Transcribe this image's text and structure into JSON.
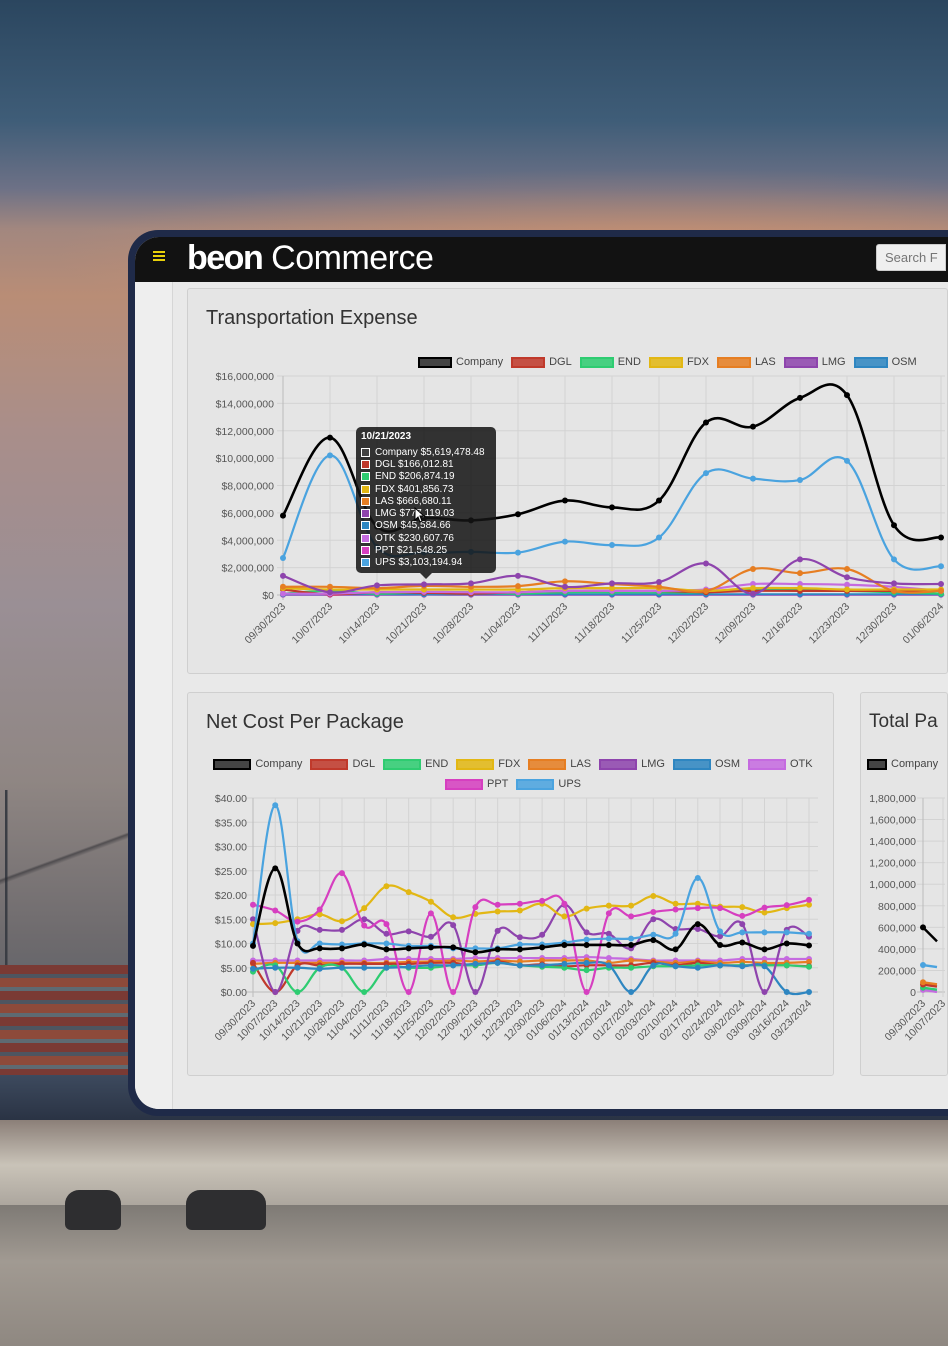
{
  "header": {
    "logo_bold": "beon",
    "logo_light": " Commerce",
    "search_placeholder": "Search F"
  },
  "colors": {
    "Company": "#000000",
    "DGL": "#c0392b",
    "END": "#2ecc71",
    "FDX": "#e2b714",
    "LAS": "#e67e22",
    "LMG": "#8e44ad",
    "OSM": "#2e86c1",
    "OTK": "#c56be0",
    "PPT": "#d63fc0",
    "UPS": "#4aa3df",
    "accent": "#e8d00a"
  },
  "tooltip": {
    "title": "10/21/2023",
    "rows": [
      {
        "series": "Company",
        "text": "Company $5,619,478.48"
      },
      {
        "series": "DGL",
        "text": "DGL $166,012.81"
      },
      {
        "series": "END",
        "text": "END $206,874.19"
      },
      {
        "series": "FDX",
        "text": "FDX $401,856.73"
      },
      {
        "series": "LAS",
        "text": "LAS $666,680.11"
      },
      {
        "series": "LMG",
        "text": "LMG $777,119.03"
      },
      {
        "series": "OSM",
        "text": "OSM $45,584.66"
      },
      {
        "series": "OTK",
        "text": "OTK $230,607.76"
      },
      {
        "series": "PPT",
        "text": "PPT $21,548.25"
      },
      {
        "series": "UPS",
        "text": "UPS $3,103,194.94"
      }
    ]
  },
  "chart_data": [
    {
      "title": "Transportation Expense",
      "type": "line",
      "legend": [
        "Company",
        "DGL",
        "END",
        "FDX",
        "LAS",
        "LMG",
        "OSM"
      ],
      "legend_placement": "top",
      "grid": true,
      "y_ticks": [
        "$0",
        "$2,000,000",
        "$4,000,000",
        "$6,000,000",
        "$8,000,000",
        "$10,000,000",
        "$12,000,000",
        "$14,000,000",
        "$16,000,000"
      ],
      "ylim": [
        0,
        16000000
      ],
      "x": [
        "09/30/2023",
        "10/07/2023",
        "10/14/2023",
        "10/21/2023",
        "10/28/2023",
        "11/04/2023",
        "11/11/2023",
        "11/18/2023",
        "11/25/2023",
        "12/02/2023",
        "12/09/2023",
        "12/16/2023",
        "12/23/2023",
        "12/30/2023",
        "01/06/2024"
      ],
      "series": [
        {
          "name": "PPT",
          "values": [
            20000,
            20000,
            20000,
            21548,
            20000,
            20000,
            20000,
            20000,
            20000,
            20000,
            20000,
            20000,
            20000,
            20000,
            20000
          ]
        },
        {
          "name": "OSM",
          "values": [
            50000,
            50000,
            50000,
            45585,
            50000,
            50000,
            50000,
            50000,
            50000,
            50000,
            50000,
            50000,
            50000,
            50000,
            50000
          ]
        },
        {
          "name": "END",
          "values": [
            100000,
            300000,
            100000,
            206874,
            200000,
            100000,
            200000,
            200000,
            200000,
            200000,
            400000,
            400000,
            300000,
            200000,
            100000
          ]
        },
        {
          "name": "DGL",
          "values": [
            400000,
            50000,
            200000,
            166013,
            100000,
            200000,
            300000,
            300000,
            300000,
            200000,
            300000,
            300000,
            300000,
            300000,
            300000
          ]
        },
        {
          "name": "OTK",
          "values": [
            100000,
            100000,
            200000,
            230608,
            200000,
            200000,
            300000,
            300000,
            300000,
            400000,
            800000,
            800000,
            750000,
            600000,
            300000
          ]
        },
        {
          "name": "FDX",
          "values": [
            500000,
            400000,
            400000,
            401857,
            400000,
            400000,
            500000,
            500000,
            500000,
            300000,
            500000,
            500000,
            400000,
            400000,
            400000
          ]
        },
        {
          "name": "LAS",
          "values": [
            600000,
            600000,
            500000,
            666680,
            600000,
            650000,
            1000000,
            800000,
            600000,
            300000,
            1900000,
            1600000,
            1900000,
            300000,
            300000
          ]
        },
        {
          "name": "LMG",
          "values": [
            1400000,
            200000,
            700000,
            777119,
            850000,
            1400000,
            600000,
            850000,
            950000,
            2300000,
            100000,
            2600000,
            1300000,
            850000,
            800000
          ]
        },
        {
          "name": "UPS",
          "values": [
            2700000,
            10200000,
            3500000,
            3103195,
            3150000,
            3100000,
            3900000,
            3650000,
            4200000,
            8900000,
            8500000,
            8400000,
            9800000,
            2600000,
            2100000
          ]
        },
        {
          "name": "Company",
          "values": [
            5800000,
            11500000,
            5000000,
            5619478,
            5450000,
            5900000,
            6900000,
            6400000,
            6900000,
            12600000,
            12300000,
            14400000,
            14600000,
            5100000,
            4200000
          ]
        }
      ]
    },
    {
      "title": "Net Cost Per Package",
      "type": "line",
      "legend": [
        "Company",
        "DGL",
        "END",
        "FDX",
        "LAS",
        "LMG",
        "OSM",
        "OTK",
        "PPT",
        "UPS"
      ],
      "legend_placement": "top",
      "grid": true,
      "y_ticks": [
        "$0.00",
        "$5.00",
        "$10.00",
        "$15.00",
        "$20.00",
        "$25.00",
        "$30.00",
        "$35.00",
        "$40.00"
      ],
      "ylim": [
        0,
        40
      ],
      "x": [
        "09/30/2023",
        "10/07/2023",
        "10/14/2023",
        "10/21/2023",
        "10/28/2023",
        "11/04/2023",
        "11/11/2023",
        "11/18/2023",
        "11/25/2023",
        "12/02/2023",
        "12/09/2023",
        "12/16/2023",
        "12/23/2023",
        "12/30/2023",
        "01/06/2024",
        "01/13/2024",
        "01/20/2024",
        "01/27/2024",
        "02/03/2024",
        "02/10/2024",
        "02/17/2024",
        "02/24/2024",
        "03/02/2024",
        "03/09/2024",
        "03/16/2024",
        "03/23/2024"
      ],
      "series": [
        {
          "name": "OTK",
          "values": [
            6.5,
            6.5,
            6.5,
            6.5,
            6.5,
            6.5,
            6.8,
            6.8,
            6.8,
            6.8,
            7,
            7,
            7,
            7,
            7,
            7.2,
            7,
            6.8,
            6.5,
            6.5,
            6.5,
            6.5,
            6.8,
            6.8,
            6.8,
            6.8
          ]
        },
        {
          "name": "LAS",
          "values": [
            5.8,
            6,
            6,
            6,
            6,
            6,
            6,
            6.2,
            6.3,
            6.5,
            6.3,
            6.5,
            6.3,
            6.5,
            6.5,
            6.5,
            6,
            6.5,
            6.3,
            6,
            6.3,
            6,
            6.2,
            6,
            6,
            6.2
          ]
        },
        {
          "name": "DGL",
          "values": [
            6,
            0,
            5.5,
            5.5,
            5.8,
            5.8,
            5.8,
            5.8,
            6,
            6,
            5.5,
            6.3,
            5.5,
            5.7,
            5.3,
            5.5,
            5.5,
            5.5,
            6,
            5.5,
            6,
            5.5,
            5.5,
            5.5,
            5.5,
            5.3
          ]
        },
        {
          "name": "END",
          "values": [
            4.2,
            5.5,
            0,
            5,
            5,
            0,
            5,
            5,
            5,
            5.5,
            5.5,
            6,
            5.5,
            5.2,
            5,
            4.5,
            5,
            5,
            5.3,
            5.3,
            5.5,
            5.5,
            5.5,
            5.5,
            5.5,
            5.2
          ]
        },
        {
          "name": "OSM",
          "values": [
            4.8,
            5,
            5,
            4.8,
            5,
            5,
            5,
            5.2,
            5.5,
            5.5,
            5.8,
            6,
            5.5,
            5.5,
            5.8,
            6,
            5.5,
            0,
            5.5,
            5.3,
            5,
            5.5,
            5.3,
            5.3,
            0,
            0
          ]
        },
        {
          "name": "LMG",
          "values": [
            15,
            0,
            12.6,
            12.8,
            12.8,
            15,
            12,
            12.5,
            11.4,
            13.8,
            0,
            12.6,
            11.3,
            11.8,
            18,
            12.3,
            12,
            9,
            15,
            13,
            13,
            11.5,
            14,
            0,
            12.8,
            11.4
          ]
        },
        {
          "name": "FDX",
          "values": [
            14,
            14.2,
            15,
            16,
            14.6,
            17.3,
            21.8,
            20.6,
            18.6,
            15.4,
            16.1,
            16.6,
            16.8,
            18.2,
            15.6,
            17.2,
            17.8,
            17.8,
            19.8,
            18.2,
            18.2,
            17.6,
            17.5,
            16.4,
            17.3,
            18
          ]
        },
        {
          "name": "PPT",
          "values": [
            18,
            16.8,
            14.5,
            17,
            24.5,
            13.7,
            14,
            0,
            16.2,
            0,
            17.5,
            18,
            18.2,
            18.8,
            18.2,
            0,
            16.2,
            15.6,
            16.5,
            17,
            17.3,
            17.3,
            15.7,
            17.4,
            17.9,
            19
          ]
        },
        {
          "name": "UPS",
          "values": [
            10,
            38.5,
            10.5,
            10,
            9.8,
            10,
            10,
            9.5,
            9.5,
            9,
            9,
            9,
            9.8,
            9.8,
            10.2,
            10.8,
            11,
            11,
            11.8,
            12,
            23.5,
            12.5,
            12.3,
            12.3,
            12.3,
            12
          ]
        },
        {
          "name": "Company",
          "values": [
            9.5,
            25.5,
            10,
            9,
            9,
            9.8,
            8.8,
            9,
            9.2,
            9.2,
            8.2,
            8.8,
            8.8,
            9.2,
            9.7,
            9.7,
            9.7,
            9.7,
            10.7,
            8.8,
            14,
            9.7,
            10.2,
            8.8,
            10,
            9.6
          ]
        }
      ]
    },
    {
      "title": "Total Pa",
      "type": "line",
      "legend": [
        "Company"
      ],
      "legend_placement": "top",
      "grid": true,
      "y_ticks": [
        "0",
        "200,000",
        "400,000",
        "600,000",
        "800,000",
        "1,000,000",
        "1,200,000",
        "1,400,000",
        "1,600,000",
        "1,800,000"
      ],
      "ylim": [
        0,
        1800000
      ],
      "x": [
        "09/30/2023",
        "10/07/2023"
      ],
      "series": [
        {
          "name": "OTK",
          "values": [
            20000
          ]
        },
        {
          "name": "END",
          "values": [
            40000
          ]
        },
        {
          "name": "DGL",
          "values": [
            70000
          ]
        },
        {
          "name": "LAS",
          "values": [
            90000
          ]
        },
        {
          "name": "UPS",
          "values": [
            250000
          ]
        },
        {
          "name": "Company",
          "values": [
            600000
          ]
        }
      ]
    }
  ]
}
